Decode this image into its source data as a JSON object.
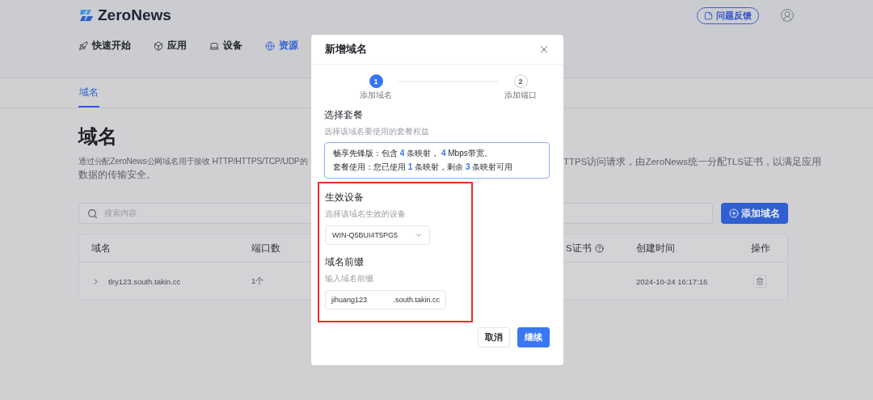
{
  "brand": {
    "name": "ZeroNews"
  },
  "nav": [
    {
      "label": "快速开始",
      "selected": false
    },
    {
      "label": "应用",
      "selected": false
    },
    {
      "label": "设备",
      "selected": false
    },
    {
      "label": "资源",
      "selected": true
    }
  ],
  "feedback_button": "问题反馈",
  "tabs": [
    {
      "label": "域名",
      "selected": true
    }
  ],
  "page": {
    "title": "域名",
    "description_left": "通过分配ZeroNews公网域名用于接收 HTTP/HTTPS/TCP/UDP的",
    "description_right": "TTPS访问请求，由ZeroNews统一分配TLS证书，以满足应用",
    "description_line2": "数据的传输安全。"
  },
  "search": {
    "placeholder": "搜索内容"
  },
  "add_button": "添加域名",
  "table": {
    "columns": [
      {
        "label": "域名"
      },
      {
        "label": "端口数"
      },
      {},
      {
        "label": "S证书",
        "help": true
      },
      {
        "label": "创建时间"
      },
      {
        "label": "操作"
      }
    ],
    "rows": [
      {
        "domain": "tlry123.south.takin.cc",
        "ports": "1个",
        "created": "2024-10-24 16:17:16"
      }
    ]
  },
  "dialog": {
    "title": "新增域名",
    "steps": [
      {
        "number": "1",
        "label": "添加域名",
        "selected": true
      },
      {
        "number": "2",
        "label": "添加端口",
        "selected": false
      }
    ],
    "plan": {
      "title": "选择套餐",
      "hint": "选择该域名要使用的套餐权益",
      "lines": [
        [
          {
            "text": "畅享先锋版：包含 ",
            "highlight": false
          },
          {
            "text": "4",
            "highlight": true
          },
          {
            "text": " 条映射， ",
            "highlight": false
          },
          {
            "text": "4",
            "highlight": true
          },
          {
            "text": " Mbps带宽。",
            "highlight": false
          }
        ],
        [
          {
            "text": "套餐使用：您已使用 ",
            "highlight": false
          },
          {
            "text": "1",
            "highlight": true
          },
          {
            "text": " 条映射，剩余 ",
            "highlight": false
          },
          {
            "text": "3",
            "highlight": true
          },
          {
            "text": " 条映射可用",
            "highlight": false
          }
        ]
      ]
    },
    "device": {
      "title": "生效设备",
      "hint": "选择该域名生效的设备",
      "value": "WIN-Q5BUI4T5PG5"
    },
    "prefix": {
      "title": "域名前缀",
      "hint": "输入域名前缀",
      "value": "jihuang123",
      "suffix": ".south.takin.cc"
    },
    "buttons": [
      {
        "label": "取消",
        "kind": "secondary"
      },
      {
        "label": "继续",
        "kind": "primary"
      }
    ]
  }
}
